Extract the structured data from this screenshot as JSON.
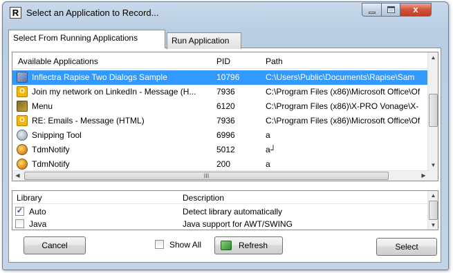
{
  "window": {
    "title": "Select an Application to Record...",
    "app_icon_letter": "R"
  },
  "titlebar_buttons": {
    "close_glyph": "x"
  },
  "tabs": [
    {
      "label": "Select From Running Applications",
      "active": true
    },
    {
      "label": "Run Application",
      "active": false
    }
  ],
  "apps_table": {
    "columns": [
      "Available Applications",
      "PID",
      "Path"
    ],
    "rows": [
      {
        "icon": "inflectra-icon",
        "name": "Inflectra Rapise Two Dialogs Sample",
        "pid": "10796",
        "path": "C:\\Users\\Public\\Documents\\Rapise\\Sam",
        "selected": true
      },
      {
        "icon": "outlook-icon",
        "icon_letter": "O",
        "name": "Join my network on LinkedIn - Message (H...",
        "pid": "7936",
        "path": "C:\\Program Files (x86)\\Microsoft Office\\Of"
      },
      {
        "icon": "xpro-vonage-icon",
        "name": "Menu",
        "pid": "6120",
        "path": "C:\\Program Files (x86)\\X-PRO Vonage\\X-"
      },
      {
        "icon": "outlook-icon",
        "icon_letter": "O",
        "name": "RE: Emails - Message (HTML)",
        "pid": "7936",
        "path": "C:\\Program Files (x86)\\Microsoft Office\\Of"
      },
      {
        "icon": "snipping-tool-icon",
        "name": "Snipping Tool",
        "pid": "6996",
        "path": "a"
      },
      {
        "icon": "tdmnotify-icon",
        "name": "TdmNotify",
        "pid": "5012",
        "path": "a┘"
      },
      {
        "icon": "tdmnotify-icon",
        "name": "TdmNotify",
        "pid": "200",
        "path": "a"
      }
    ],
    "hscroll_thumb_grip": "III",
    "vscroll_up": "▲",
    "vscroll_down": "▼",
    "hscroll_left": "◀",
    "hscroll_right": "▶"
  },
  "library_table": {
    "columns": [
      "Library",
      "Description"
    ],
    "rows": [
      {
        "name": "Auto",
        "description": "Detect library automatically",
        "checked": true,
        "check_glyph": "✓"
      },
      {
        "name": "Java",
        "description": "Java support for AWT/SWING",
        "checked": false,
        "check_glyph": ""
      }
    ]
  },
  "footer": {
    "cancel_label": "Cancel",
    "show_all_label": "Show All",
    "show_all_checked": false,
    "refresh_label": "Refresh",
    "select_label": "Select"
  }
}
